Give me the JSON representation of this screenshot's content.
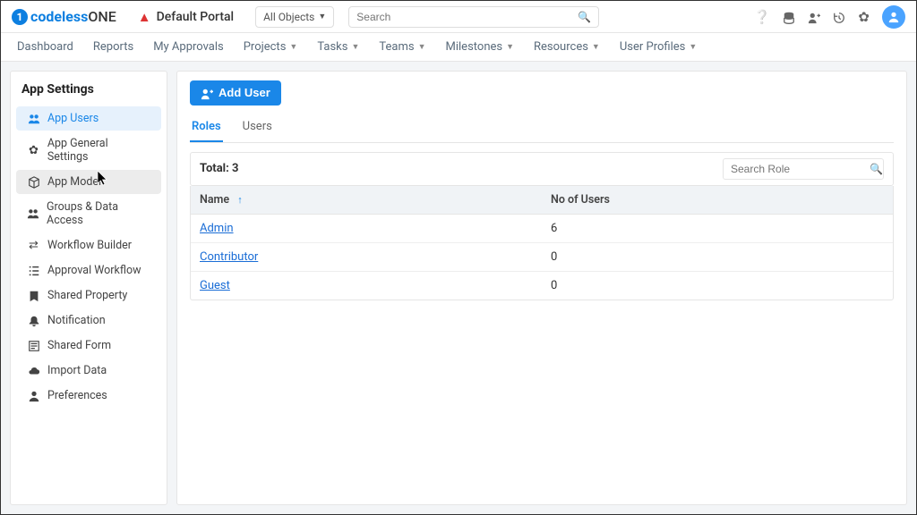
{
  "header": {
    "logo_codeless": "codeless",
    "logo_one": "ONE",
    "portal_title": "Default Portal",
    "object_selector": "All Objects",
    "search_placeholder": "Search"
  },
  "topnav": [
    {
      "label": "Dashboard",
      "dropdown": false
    },
    {
      "label": "Reports",
      "dropdown": false
    },
    {
      "label": "My Approvals",
      "dropdown": false
    },
    {
      "label": "Projects",
      "dropdown": true
    },
    {
      "label": "Tasks",
      "dropdown": true
    },
    {
      "label": "Teams",
      "dropdown": true
    },
    {
      "label": "Milestones",
      "dropdown": true
    },
    {
      "label": "Resources",
      "dropdown": true
    },
    {
      "label": "User Profiles",
      "dropdown": true
    }
  ],
  "sidebar": {
    "title": "App Settings",
    "items": [
      {
        "icon": "users",
        "label": "App Users",
        "state": "active"
      },
      {
        "icon": "gear",
        "label": "App General Settings",
        "state": ""
      },
      {
        "icon": "cube",
        "label": "App Model",
        "state": "hover"
      },
      {
        "icon": "group",
        "label": "Groups & Data Access",
        "state": ""
      },
      {
        "icon": "swap",
        "label": "Workflow Builder",
        "state": ""
      },
      {
        "icon": "list",
        "label": "Approval Workflow",
        "state": ""
      },
      {
        "icon": "bookmark",
        "label": "Shared Property",
        "state": ""
      },
      {
        "icon": "bell",
        "label": "Notification",
        "state": ""
      },
      {
        "icon": "form",
        "label": "Shared Form",
        "state": ""
      },
      {
        "icon": "cloud",
        "label": "Import Data",
        "state": ""
      },
      {
        "icon": "person",
        "label": "Preferences",
        "state": ""
      }
    ]
  },
  "main": {
    "add_user_label": "Add User",
    "tabs": [
      {
        "label": "Roles",
        "active": true
      },
      {
        "label": "Users",
        "active": false
      }
    ],
    "total_label": "Total: 3",
    "search_role_placeholder": "Search Role",
    "columns": [
      {
        "label": "Name",
        "sort": "asc"
      },
      {
        "label": "No of Users"
      }
    ],
    "rows": [
      {
        "name": "Admin",
        "users": "6"
      },
      {
        "name": "Contributor",
        "users": "0"
      },
      {
        "name": "Guest",
        "users": "0"
      }
    ]
  }
}
